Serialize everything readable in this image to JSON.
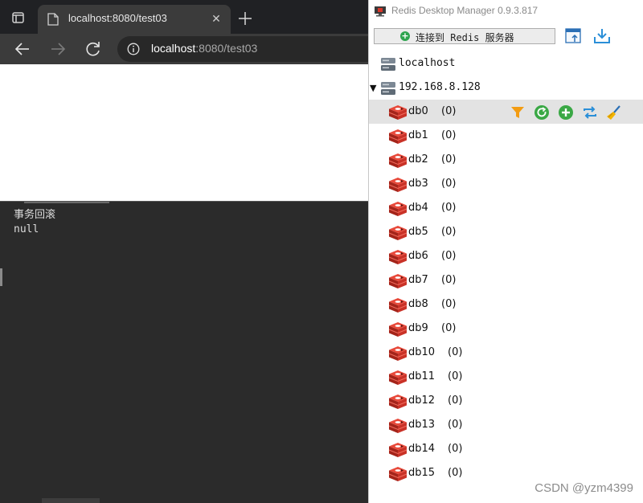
{
  "browser": {
    "tab": {
      "title": "localhost:8080/test03"
    },
    "address": {
      "host": "localhost",
      "rest": ":8080/test03"
    },
    "console": {
      "lines": [
        "事务回滚",
        "null"
      ]
    }
  },
  "rdm": {
    "window_title": "Redis Desktop Manager 0.9.3.817",
    "connect_label": "连接到 Redis 服务器",
    "servers": [
      {
        "name": "localhost",
        "expanded": false
      },
      {
        "name": "192.168.8.128",
        "expanded": true
      }
    ],
    "databases": [
      {
        "name": "db0",
        "count": "(0)",
        "selected": true
      },
      {
        "name": "db1",
        "count": "(0)"
      },
      {
        "name": "db2",
        "count": "(0)"
      },
      {
        "name": "db3",
        "count": "(0)"
      },
      {
        "name": "db4",
        "count": "(0)"
      },
      {
        "name": "db5",
        "count": "(0)"
      },
      {
        "name": "db6",
        "count": "(0)"
      },
      {
        "name": "db7",
        "count": "(0)"
      },
      {
        "name": "db8",
        "count": "(0)"
      },
      {
        "name": "db9",
        "count": "(0)"
      },
      {
        "name": "db10",
        "count": "(0)"
      },
      {
        "name": "db11",
        "count": "(0)"
      },
      {
        "name": "db12",
        "count": "(0)"
      },
      {
        "name": "db13",
        "count": "(0)"
      },
      {
        "name": "db14",
        "count": "(0)"
      },
      {
        "name": "db15",
        "count": "(0)"
      }
    ],
    "row_actions": [
      "filter-icon",
      "reload-icon",
      "add-key-icon",
      "swap-icon",
      "flush-icon"
    ]
  },
  "watermark": "CSDN @yzm4399",
  "colors": {
    "browser_bg": "#202124",
    "console_bg": "#2b2b2b",
    "selected_row": "#e3e3e3",
    "redis_red": "#d7372a",
    "filter_orange": "#f39c12",
    "action_green": "#3aa845",
    "action_blue": "#2b8fd8"
  }
}
